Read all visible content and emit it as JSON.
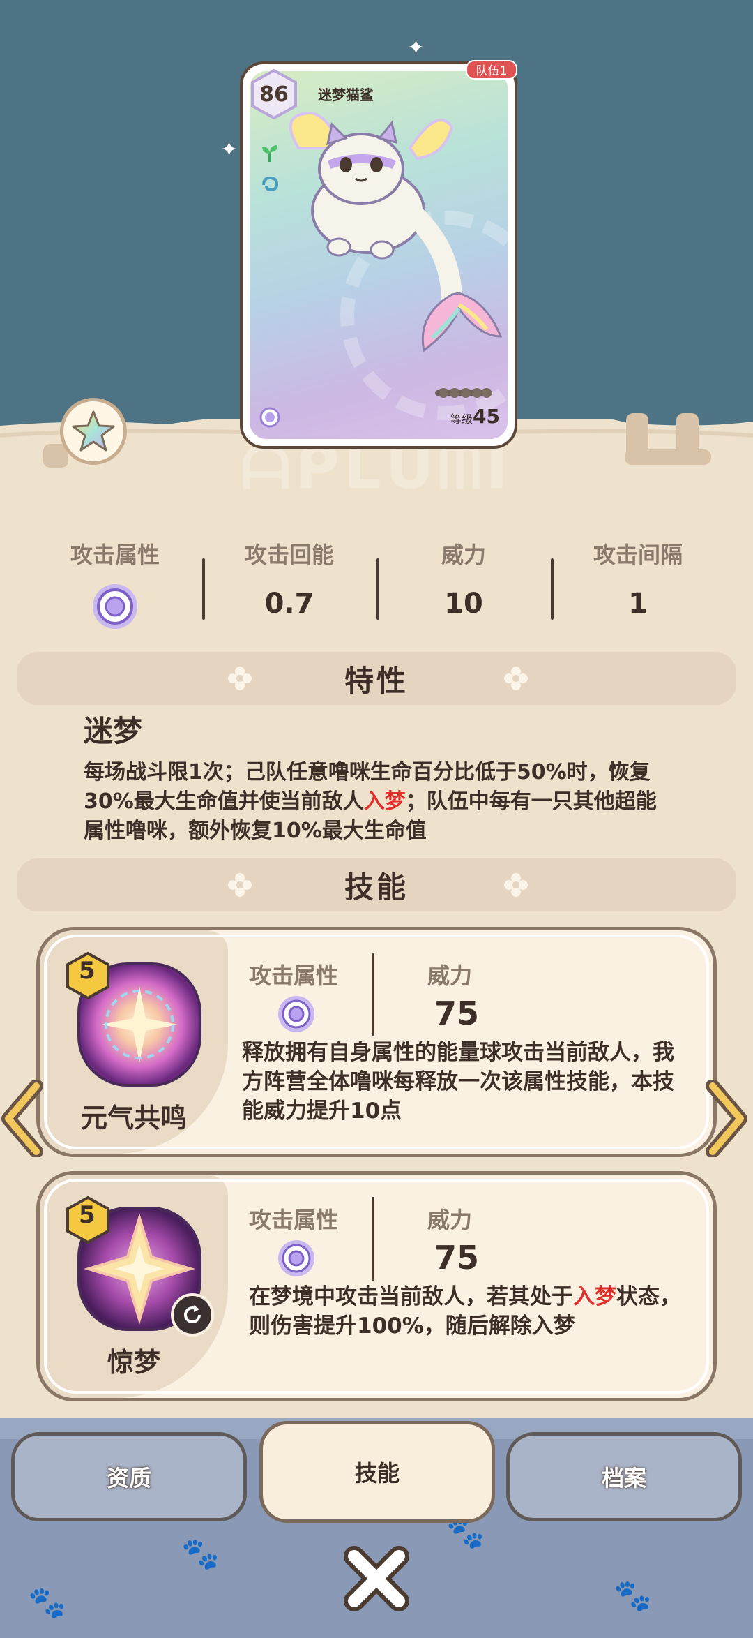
{
  "card": {
    "team_tag": "队伍1",
    "level_badge": "86",
    "name": "迷梦猫鲨",
    "rank_label": "等级",
    "rank_value": "45"
  },
  "stats": [
    {
      "label": "攻击属性",
      "value": ""
    },
    {
      "label": "攻击回能",
      "value": "0.7"
    },
    {
      "label": "威力",
      "value": "10"
    },
    {
      "label": "攻击间隔",
      "value": "1"
    }
  ],
  "trait_section": {
    "title": "特性",
    "name": "迷梦",
    "text_part1": "每场战斗限1次；己队任意噜咪生命百分比低于50%时，恢复30%最大生命值并使当前敌人",
    "text_highlight": "入梦",
    "text_part2": "；队伍中每有一只其他超能属性噜咪，额外恢复10%最大生命值"
  },
  "skill_section": {
    "title": "技能"
  },
  "skills": [
    {
      "level": "5",
      "name": "元气共鸣",
      "attr_label": "攻击属性",
      "power_label": "威力",
      "power": "75",
      "desc": "释放拥有自身属性的能量球攻击当前敌人，我方阵营全体噜咪每释放一次该属性技能，本技能威力提升10点"
    },
    {
      "level": "5",
      "name": "惊梦",
      "attr_label": "攻击属性",
      "power_label": "威力",
      "power": "75",
      "desc_part1": "在梦境中攻击当前敌人，若其处于",
      "desc_highlight": "入梦",
      "desc_part2": "状态，则伤害提升100%，随后解除入梦"
    }
  ],
  "tabs": [
    {
      "label": "资质",
      "active": false
    },
    {
      "label": "技能",
      "active": true
    },
    {
      "label": "档案",
      "active": false
    }
  ],
  "icons": {
    "attribute": "psychic-orb-icon",
    "close": "close-x-icon",
    "prev": "chevron-left-icon",
    "next": "chevron-right-icon"
  },
  "colors": {
    "sky": "#4d7384",
    "sand": "#efe2cd",
    "highlight_red": "#e0302c",
    "tab_bar": "#8a9ab6"
  }
}
